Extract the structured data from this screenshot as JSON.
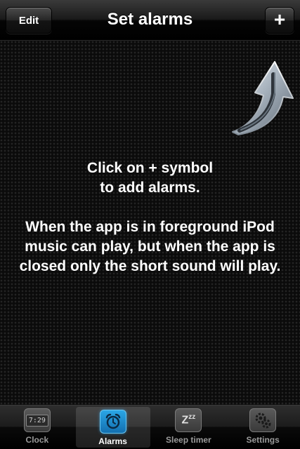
{
  "navbar": {
    "title": "Set alarms",
    "edit_label": "Edit",
    "add_label": "+"
  },
  "main": {
    "message_lines_1": [
      "Click on + symbol",
      "to add alarms."
    ],
    "message_lines_2": [
      "When the app is in foreground iPod",
      "music can play, but when the app is",
      "closed only the short sound will play."
    ],
    "hint_icon": "curved-arrow-up-right-icon"
  },
  "tabbar": {
    "tabs": [
      {
        "label": "Clock",
        "icon": "clock-icon",
        "icon_text": "7:29",
        "selected": false
      },
      {
        "label": "Alarms",
        "icon": "alarm-clock-icon",
        "selected": true
      },
      {
        "label": "Sleep timer",
        "icon": "sleep-zzz-icon",
        "selected": false
      },
      {
        "label": "Settings",
        "icon": "gears-icon",
        "selected": false
      }
    ]
  },
  "colors": {
    "accent": "#1e8fd6",
    "background": "#000000",
    "text": "#ffffff",
    "tab_inactive_text": "#9a9a9a"
  }
}
